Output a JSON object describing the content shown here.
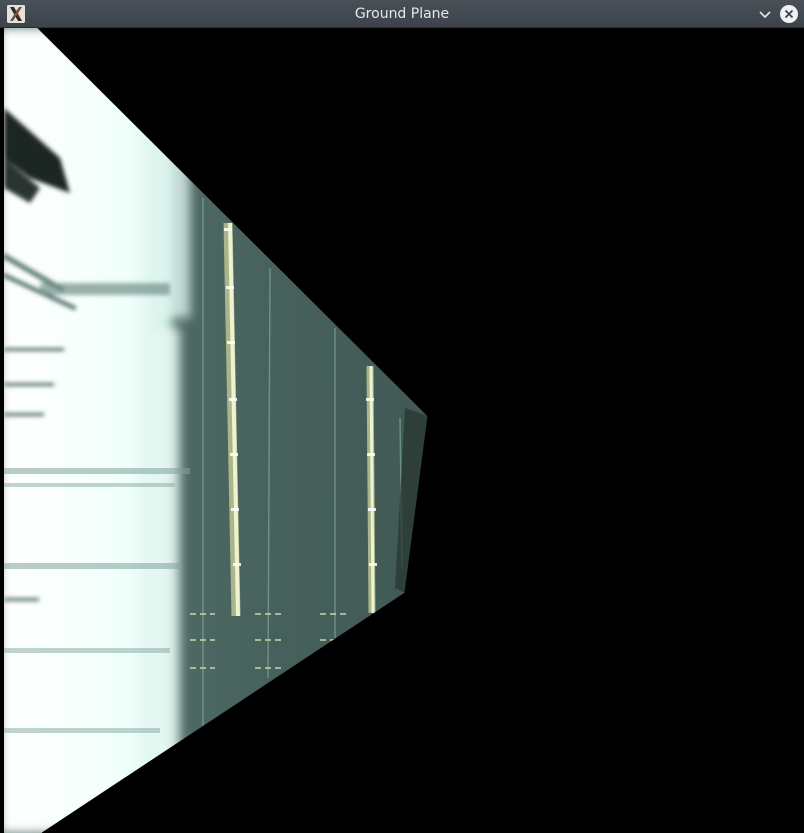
{
  "window": {
    "title": "Ground Plane",
    "icons": {
      "app": "x-app-icon",
      "minimize": "chevron-down-icon",
      "close": "close-icon"
    }
  },
  "canvas": {
    "description_colors": {
      "background": "#000000",
      "floor": "#3c514d",
      "bright": "#f2fffb",
      "glow": "#bfe6dc",
      "rail": "#dfe6b4"
    }
  }
}
